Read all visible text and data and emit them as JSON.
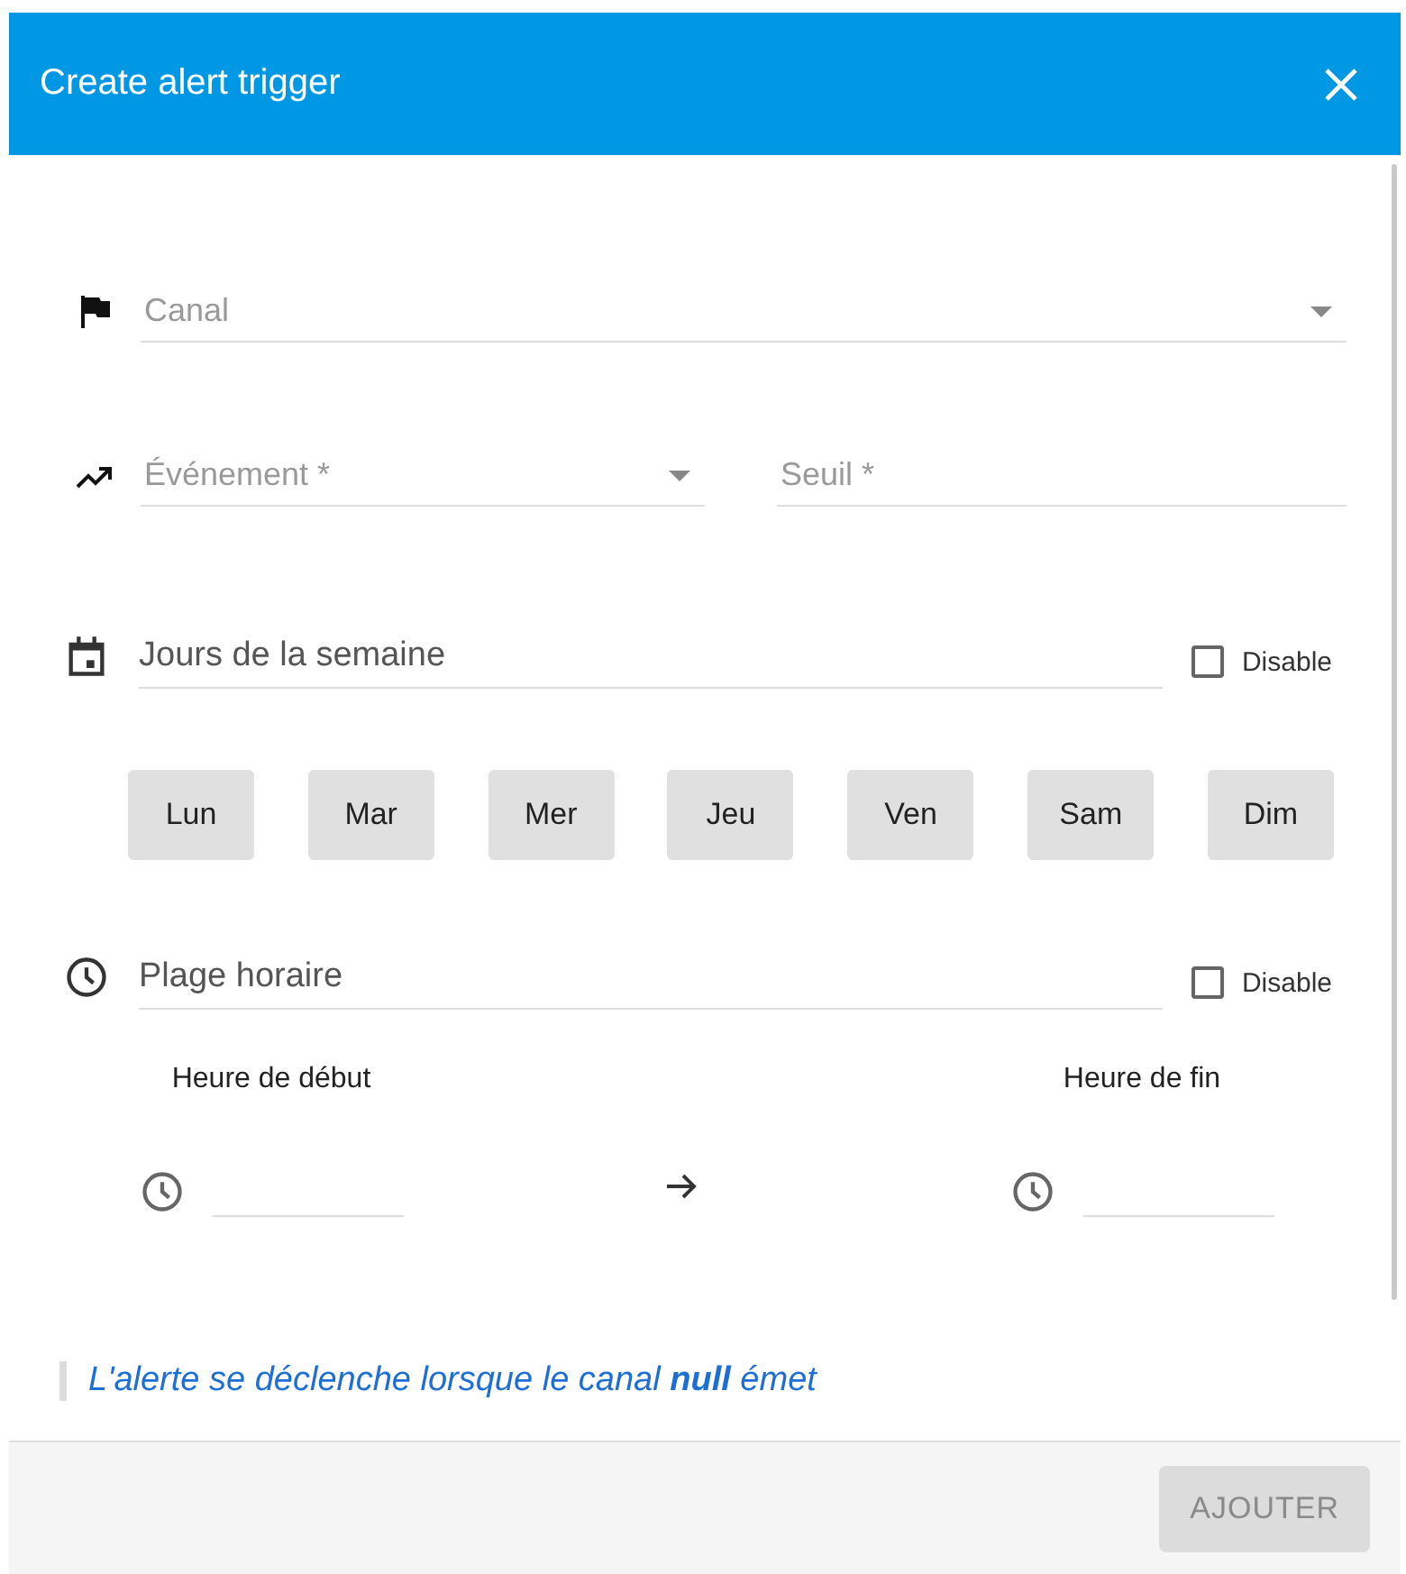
{
  "dialog": {
    "title": "Create alert trigger"
  },
  "fields": {
    "channel": {
      "placeholder": "Canal"
    },
    "event": {
      "placeholder": "Événement *"
    },
    "threshold": {
      "placeholder": "Seuil *"
    }
  },
  "days_section": {
    "label": "Jours de la semaine",
    "disable": {
      "label": "Disable",
      "checked": false
    },
    "days": [
      {
        "label": "Lun",
        "selected": false
      },
      {
        "label": "Mar",
        "selected": false
      },
      {
        "label": "Mer",
        "selected": false
      },
      {
        "label": "Jeu",
        "selected": false
      },
      {
        "label": "Ven",
        "selected": false
      },
      {
        "label": "Sam",
        "selected": false
      },
      {
        "label": "Dim",
        "selected": false
      }
    ]
  },
  "time_section": {
    "label": "Plage horaire",
    "disable": {
      "label": "Disable",
      "checked": false
    },
    "start": {
      "label": "Heure de début"
    },
    "end": {
      "label": "Heure de fin"
    }
  },
  "note": "L'alerte se déclenche lorsque le canal **null** émet",
  "footer": {
    "submit": {
      "label": "AJOUTER",
      "disabled": true
    }
  }
}
